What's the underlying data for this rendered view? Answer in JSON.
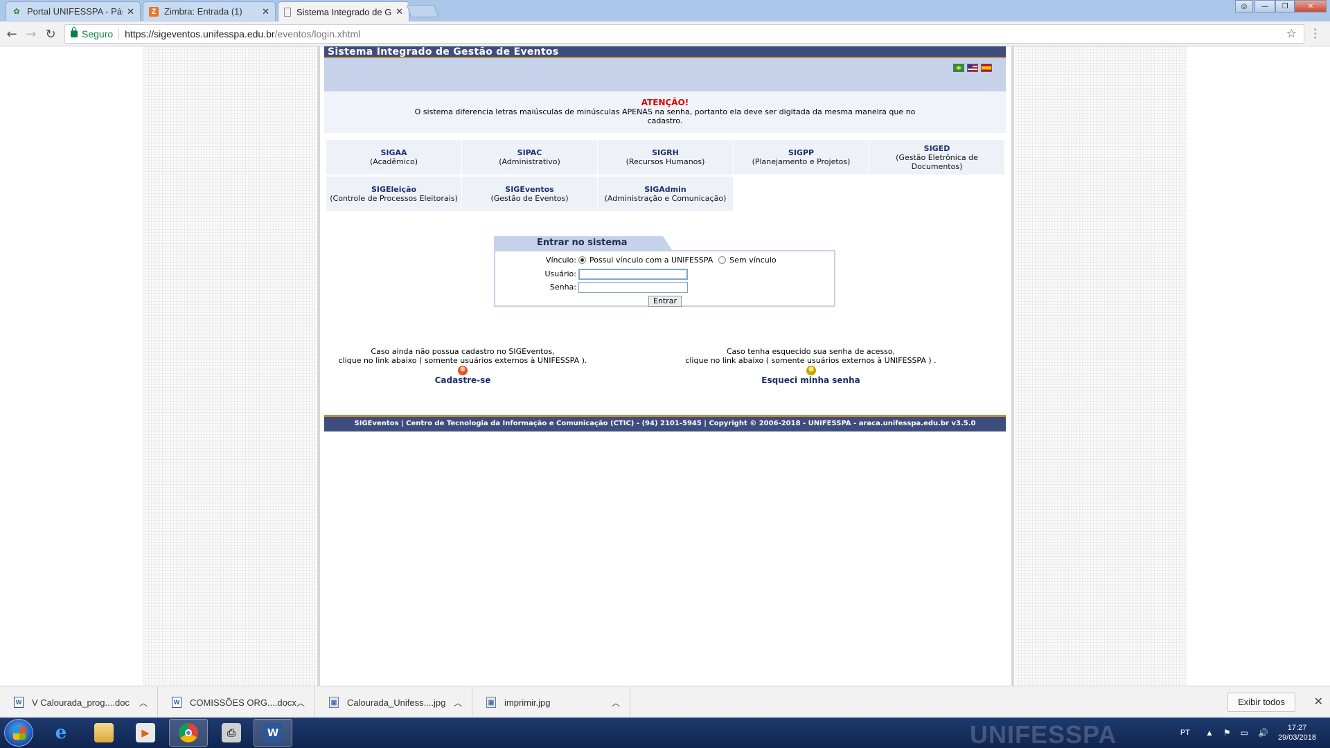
{
  "browser": {
    "tabs": [
      {
        "title": "Portal UNIFESSPA - Págin",
        "icon": "unifesspa-favicon"
      },
      {
        "title": "Zimbra: Entrada (1)",
        "icon": "zimbra-favicon"
      },
      {
        "title": "Sistema Integrado de Ge",
        "icon": "page-favicon"
      }
    ],
    "secure_label": "Seguro",
    "url_host": "https://sigeventos.unifesspa.edu.br",
    "url_path": "/eventos/login.xhtml"
  },
  "page": {
    "header_title": "Sistema Integrado de Gestão de Eventos",
    "notice_title": "ATENÇÃO!",
    "notice_text": "O sistema diferencia letras maiúsculas de minúsculas APENAS na senha, portanto ela deve ser digitada da mesma maneira que no cadastro.",
    "systems": [
      {
        "name": "SIGAA",
        "desc": "(Acadêmico)"
      },
      {
        "name": "SIPAC",
        "desc": "(Administrativo)"
      },
      {
        "name": "SIGRH",
        "desc": "(Recursos Humanos)"
      },
      {
        "name": "SIGPP",
        "desc": "(Planejamento e Projetos)"
      },
      {
        "name": "SIGED",
        "desc": "(Gestão Eletrônica de Documentos)"
      },
      {
        "name": "SIGEleição",
        "desc": "(Controle de Processos Eleitorais)"
      },
      {
        "name": "SIGEventos",
        "desc": "(Gestão de Eventos)"
      },
      {
        "name": "SIGAdmin",
        "desc": "(Administração e Comunicação)"
      }
    ],
    "login": {
      "title": "Entrar no sistema",
      "vinculo_label": "Vínculo:",
      "option_with": "Possui vínculo com a UNIFESSPA",
      "option_without": "Sem vínculo",
      "user_label": "Usuário:",
      "pass_label": "Senha:",
      "submit": "Entrar"
    },
    "register": {
      "line1": "Caso ainda não possua cadastro no SIGEventos,",
      "line2": "clique no link abaixo ( somente usuários externos à UNIFESSPA ).",
      "link": "Cadastre-se"
    },
    "forgot": {
      "line1": "Caso tenha esquecido sua senha de acesso,",
      "line2": "clique no link abaixo ( somente usuários externos à UNIFESSPA ) .",
      "link": "Esqueci minha senha"
    },
    "footer": "SIGEventos | Centro de Tecnologia da Informação e Comunicação (CTIC) - (94) 2101-5945 | Copyright © 2006-2018 - UNIFESSPA - araca.unifesspa.edu.br v3.5.0"
  },
  "downloads": {
    "items": [
      {
        "name": "V Calourada_prog....doc",
        "type": "word"
      },
      {
        "name": "COMISSÕES ORG....docx",
        "type": "word"
      },
      {
        "name": "Calourada_Unifess....jpg",
        "type": "image"
      },
      {
        "name": "imprimir.jpg",
        "type": "image"
      }
    ],
    "show_all": "Exibir todos"
  },
  "taskbar": {
    "lang": "PT",
    "time": "17:27",
    "date": "29/03/2018",
    "watermark": "UNIFESSPA"
  }
}
